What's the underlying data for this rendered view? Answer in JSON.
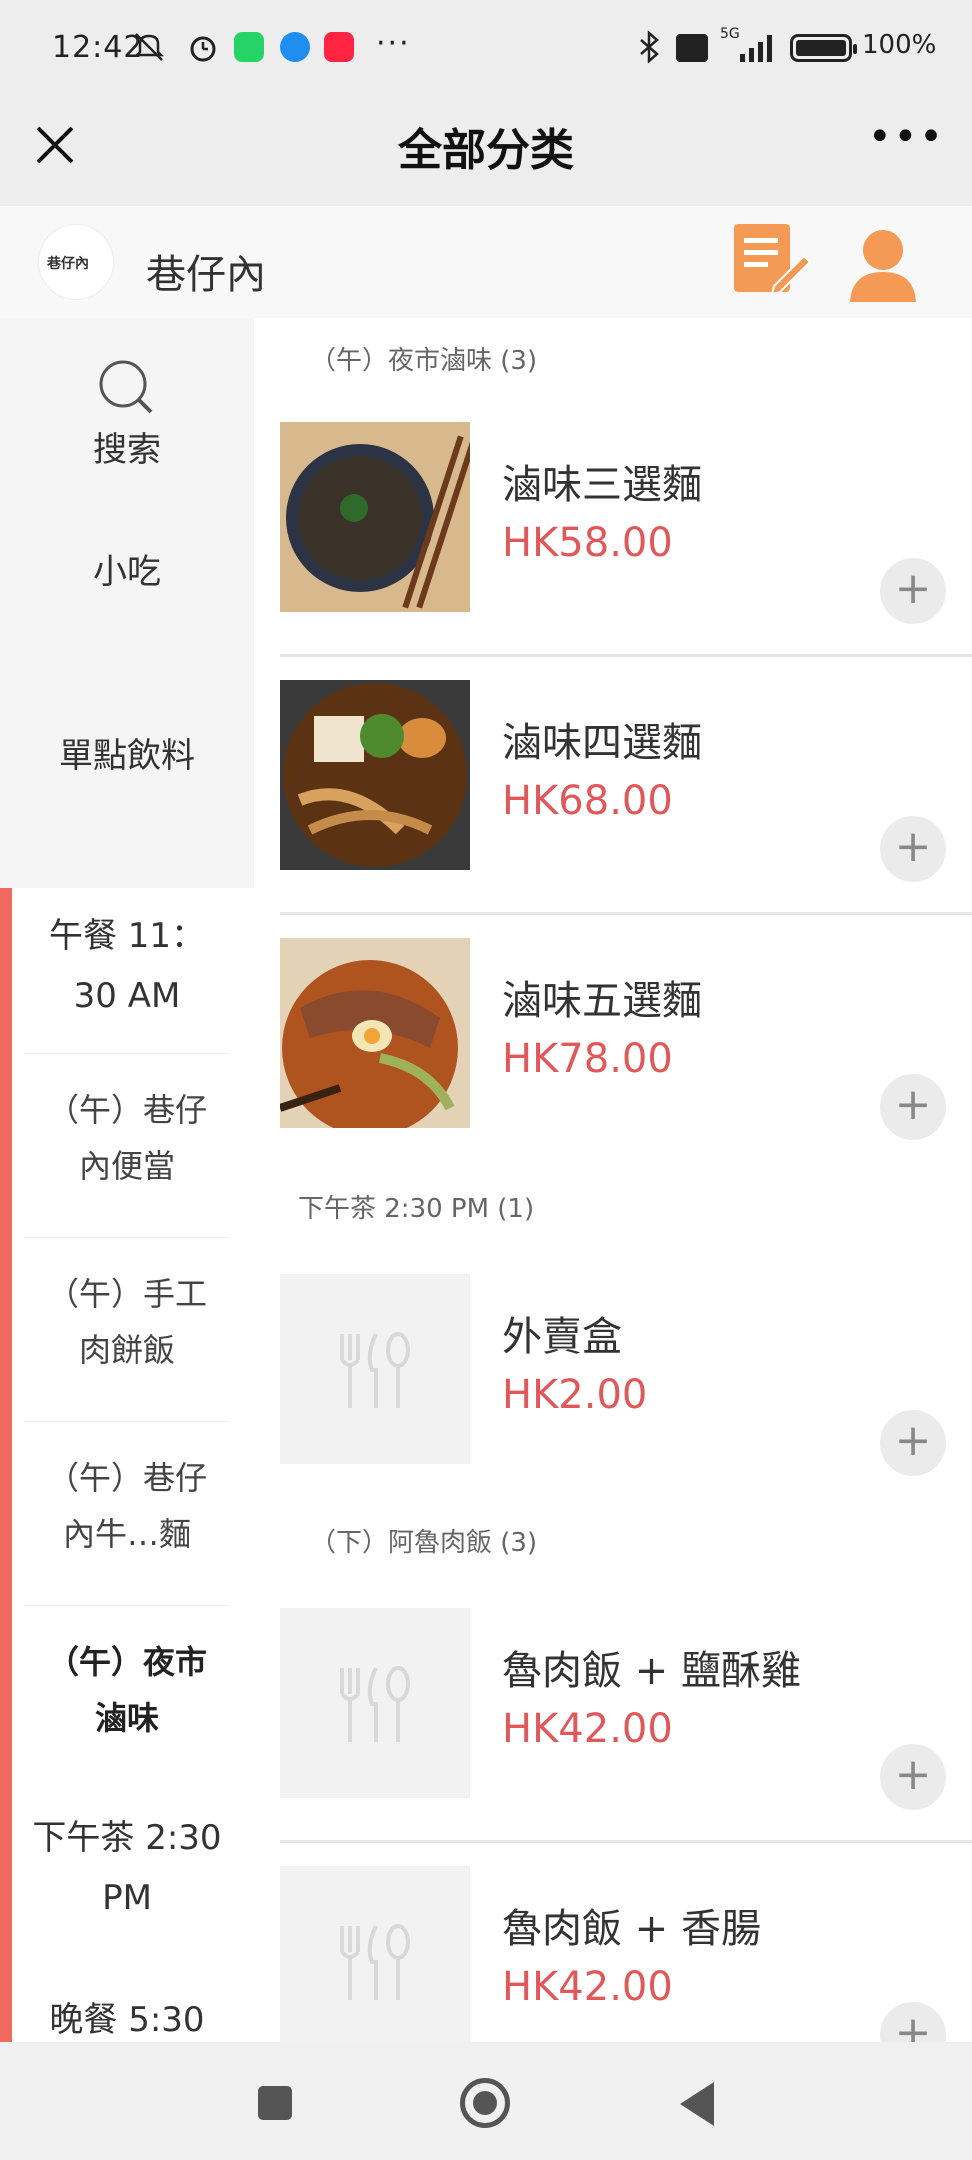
{
  "status_bar": {
    "time": "12:42",
    "more": "···",
    "network": "5G",
    "battery_text": "100%",
    "app_label_xhs": "小红书"
  },
  "title_bar": {
    "title": "全部分类",
    "close_icon": "close-icon",
    "more_label": "•••"
  },
  "store": {
    "name": "巷仔內",
    "logo_text": "巷仔內"
  },
  "sidebar": {
    "search_label": "搜索",
    "items": [
      "小吃",
      "單點飲料"
    ],
    "meal_header": "午餐 11：30 AM",
    "subitems": [
      "（午）巷仔內便當",
      "（午）手工肉餅飯",
      "（午）巷仔內牛…麵",
      "（午）夜市滷味"
    ],
    "active_subitem": "（午）夜市滷味",
    "after_items": [
      "下午茶 2:30 PM",
      "晚餐 5:30"
    ]
  },
  "sections": [
    {
      "title": "（午）夜市滷味 (3)",
      "products": [
        {
          "name": "滷味三選麵",
          "price": "HK58.00"
        },
        {
          "name": "滷味四選麵",
          "price": "HK68.00"
        },
        {
          "name": "滷味五選麵",
          "price": "HK78.00"
        }
      ]
    },
    {
      "title": "下午茶 2:30 PM (1)",
      "products": [
        {
          "name": "外賣盒",
          "price": "HK2.00"
        }
      ]
    },
    {
      "title": "（下）阿魯肉飯 (3)",
      "products": [
        {
          "name": "魯肉飯 + 鹽酥雞",
          "price": "HK42.00"
        },
        {
          "name": "魯肉飯 + 香腸",
          "price": "HK42.00"
        }
      ]
    }
  ],
  "add_label": "+",
  "colors": {
    "price": "#e0585a",
    "accent_bar": "#f0695f",
    "icon_orange": "#f59a55"
  }
}
